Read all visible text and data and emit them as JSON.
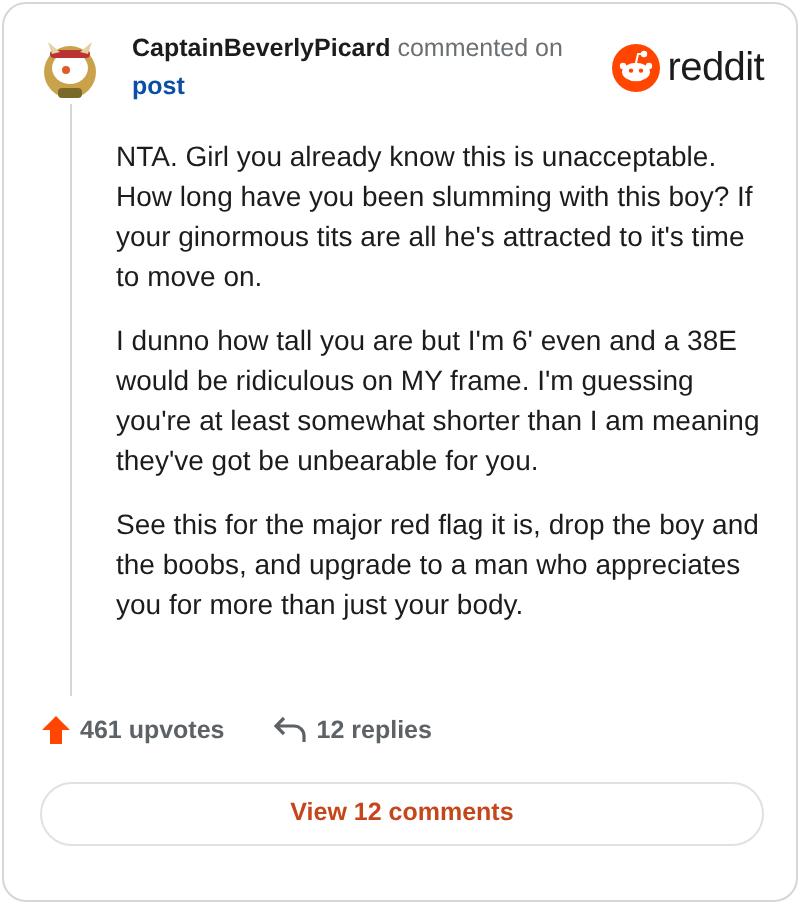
{
  "header": {
    "username": "CaptainBeverlyPicard",
    "action": "commented on",
    "link": "post",
    "logo_text": "reddit"
  },
  "paragraphs": [
    "NTA. Girl you already know this is unacceptable. How long have you been slumming with this boy? If your ginormous tits are all he's attracted to it's time to move on.",
    "I dunno how tall you are but I'm 6' even and a 38E would be ridiculous on MY frame. I'm guessing you're at least somewhat shorter than I am meaning they've got be unbearable for you.",
    "See this for the major red flag it is, drop the boy and the boobs, and upgrade to a man who appreciates you for more than just your body."
  ],
  "footer": {
    "upvotes": "461 upvotes",
    "replies": "12 replies"
  },
  "button": "View 12 comments"
}
